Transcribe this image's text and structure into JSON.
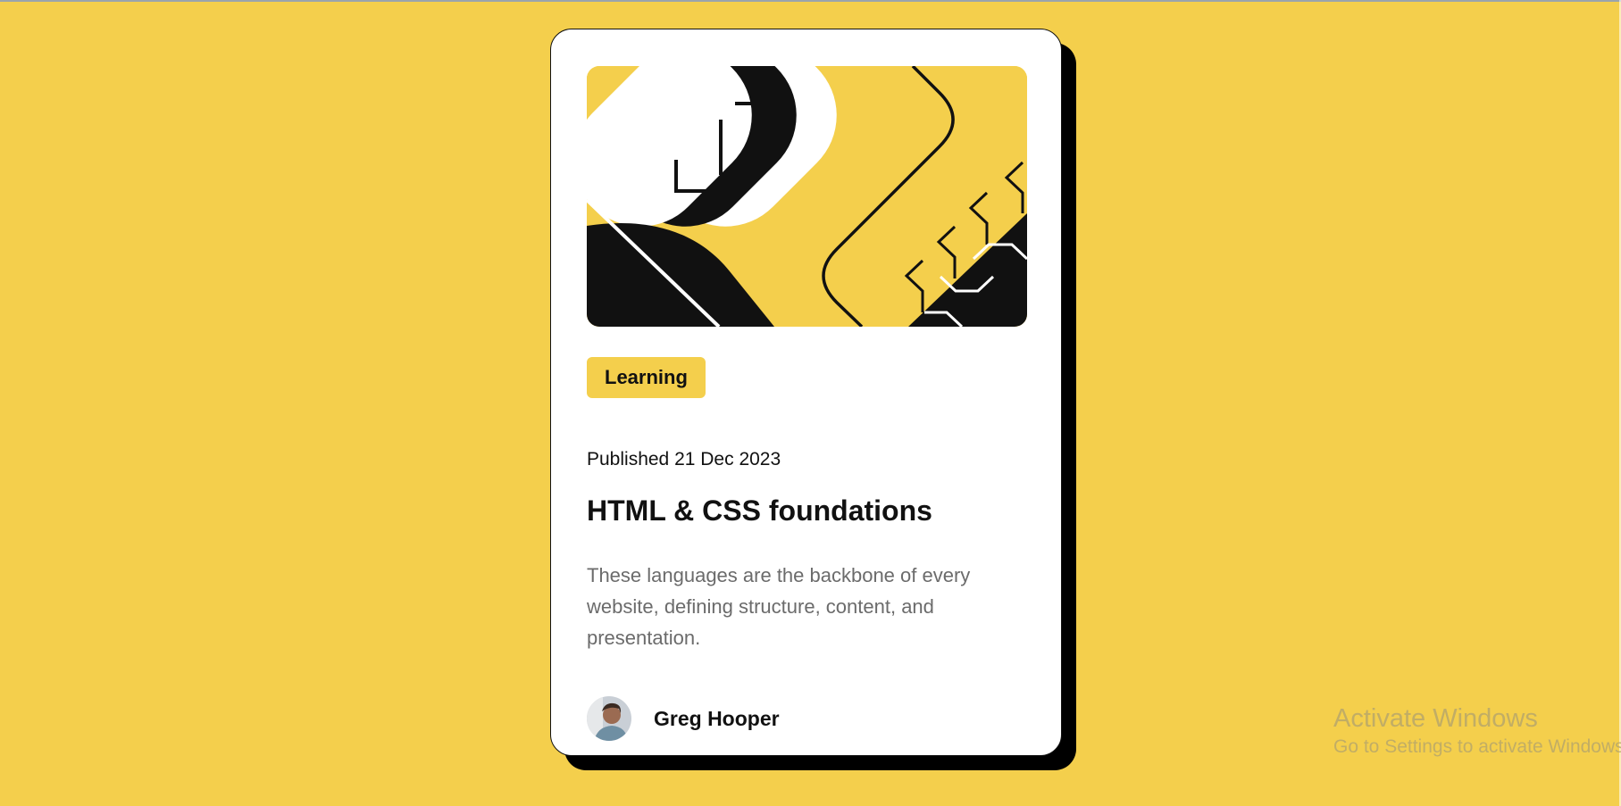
{
  "card": {
    "tag_label": "Learning",
    "published": "Published 21 Dec 2023",
    "title": "HTML & CSS foundations",
    "description": "These languages are the backbone of every website, defining structure, content, and presentation.",
    "author": {
      "name": "Greg Hooper",
      "avatar_icon": "person-avatar-icon"
    },
    "hero_icon": "abstract-illustration-icon"
  },
  "os_watermark": {
    "title": "Activate Windows",
    "subtitle": "Go to Settings to activate Windows."
  },
  "colors": {
    "background": "#f4cf4c",
    "card": "#ffffff",
    "text": "#111111",
    "muted_text": "#6b6b6b",
    "shadow": "#000000"
  }
}
